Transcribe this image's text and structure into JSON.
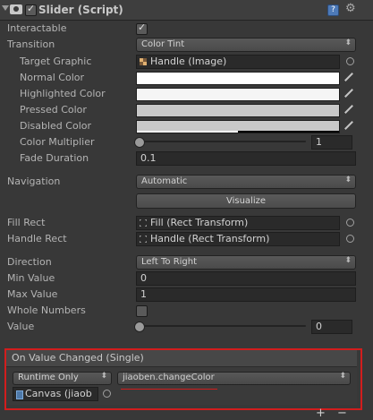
{
  "header": {
    "title": "Slider (Script)",
    "enabled": true
  },
  "fields": {
    "interactable": {
      "label": "Interactable",
      "checked": true
    },
    "transition": {
      "label": "Transition",
      "value": "Color Tint"
    },
    "target_graphic": {
      "label": "Target Graphic",
      "value": "Handle (Image)"
    },
    "normal_color": {
      "label": "Normal Color",
      "color": "#ffffff"
    },
    "highlighted_color": {
      "label": "Highlighted Color",
      "color": "#f5f5f5"
    },
    "pressed_color": {
      "label": "Pressed Color",
      "color": "#c8c8c8"
    },
    "disabled_color": {
      "label": "Disabled Color",
      "color": "#c8c8c8"
    },
    "color_multiplier": {
      "label": "Color Multiplier",
      "value": "1",
      "slider_fraction": 0.0
    },
    "fade_duration": {
      "label": "Fade Duration",
      "value": "0.1"
    },
    "navigation": {
      "label": "Navigation",
      "value": "Automatic"
    },
    "visualize": {
      "label": "Visualize"
    },
    "fill_rect": {
      "label": "Fill Rect",
      "value": "Fill (Rect Transform)"
    },
    "handle_rect": {
      "label": "Handle Rect",
      "value": "Handle (Rect Transform)"
    },
    "direction": {
      "label": "Direction",
      "value": "Left To Right"
    },
    "min_value": {
      "label": "Min Value",
      "value": "0"
    },
    "max_value": {
      "label": "Max Value",
      "value": "1"
    },
    "whole_numbers": {
      "label": "Whole Numbers",
      "checked": false
    },
    "value": {
      "label": "Value",
      "value": "0",
      "slider_fraction": 0.0
    }
  },
  "event": {
    "title": "On Value Changed (Single)",
    "runtime": "Runtime Only",
    "function": "jiaoben.changeColor",
    "object": "Canvas (jiaob",
    "add_label": "+",
    "remove_label": "−"
  }
}
